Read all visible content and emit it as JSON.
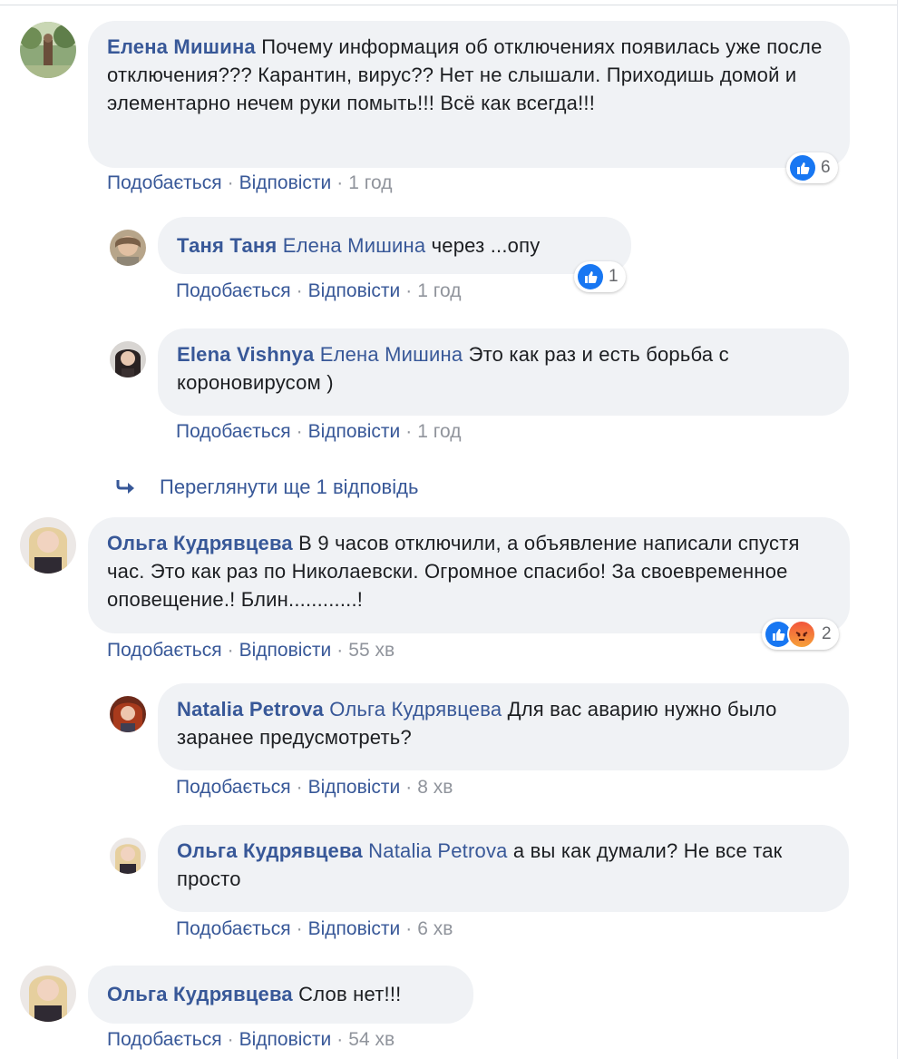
{
  "colors": {
    "link": "#385898",
    "bubble": "#f0f2f5",
    "like": "#1877f2",
    "meta": "#90949c"
  },
  "comments": [
    {
      "author": "Елена Мишина",
      "text": "Почему информация об отключениях появилась уже после отключения??? Карантин, вирус?? Нет не слышали. Приходишь домой и элементарно нечем руки помыть!!! Всё как всегда!!!",
      "like": "Подобається",
      "reply": "Відповісти",
      "time": "1 год",
      "reaction_count": "6",
      "reaction_icons": [
        "like-icon"
      ]
    },
    {
      "author": "Таня Таня",
      "mention": "Елена Мишина",
      "text": "через ...опу",
      "like": "Подобається",
      "reply": "Відповісти",
      "time": "1 год",
      "reaction_count": "1",
      "reaction_icons": [
        "like-icon"
      ]
    },
    {
      "author": "Elena Vishnya",
      "mention": "Елена Мишина",
      "text": "Это как раз и есть борьба с короновирусом )",
      "like": "Подобається",
      "reply": "Відповісти",
      "time": "1 год"
    },
    {
      "author": "Ольга Кудрявцева",
      "text": "В 9 часов отключили, а объявление написали спустя час. Это как раз по Николаевски. Огромное спасибо! За своевременное оповещение.! Блин............!",
      "like": "Подобається",
      "reply": "Відповісти",
      "time": "55 хв",
      "reaction_count": "2",
      "reaction_icons": [
        "like-icon",
        "angry-icon"
      ]
    },
    {
      "author": "Natalia Petrova",
      "mention": "Ольга Кудрявцева",
      "text": "Для вас аварию нужно было заранее предусмотреть?",
      "like": "Подобається",
      "reply": "Відповісти",
      "time": "8 хв"
    },
    {
      "author": "Ольга Кудрявцева",
      "mention": "Natalia Petrova",
      "text": "а вы как думали? Не все так просто",
      "like": "Подобається",
      "reply": "Відповісти",
      "time": "6 хв"
    },
    {
      "author": "Ольга Кудрявцева",
      "text": "Слов нет!!!",
      "like": "Подобається",
      "reply": "Відповісти",
      "time": "54 хв"
    }
  ],
  "more_replies": "Переглянути ще 1 відповідь"
}
